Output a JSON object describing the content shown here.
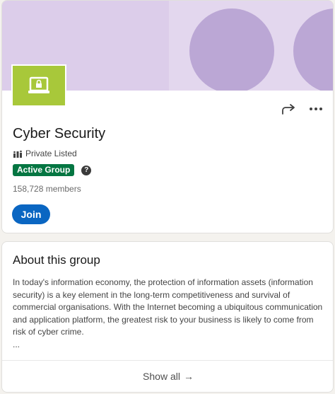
{
  "group": {
    "name": "Cyber Security",
    "privacy": "Private Listed",
    "status_badge": "Active Group",
    "help_glyph": "?",
    "members": "158,728 members",
    "join_label": "Join",
    "banner_colors": {
      "base": "#dccdea",
      "circle": "#bba7d5"
    },
    "logo_color": "#a8c83a"
  },
  "actions": {
    "share_icon": "share-icon",
    "more_icon": "more-icon"
  },
  "about": {
    "title": "About this group",
    "lines": [
      "In today's information economy, the protection of information assets (information",
      "security) is a key element in the long-term competitiveness and survival of",
      "commercial organisations. With the Internet becoming a ubiquitous communication",
      "and application platform, the greatest risk to your business is likely to come from",
      "risk of cyber crime.",
      "..."
    ],
    "show_all_label": "Show all",
    "show_all_arrow": "→"
  },
  "colors": {
    "join": "#0a66c2",
    "badge": "#057642"
  }
}
